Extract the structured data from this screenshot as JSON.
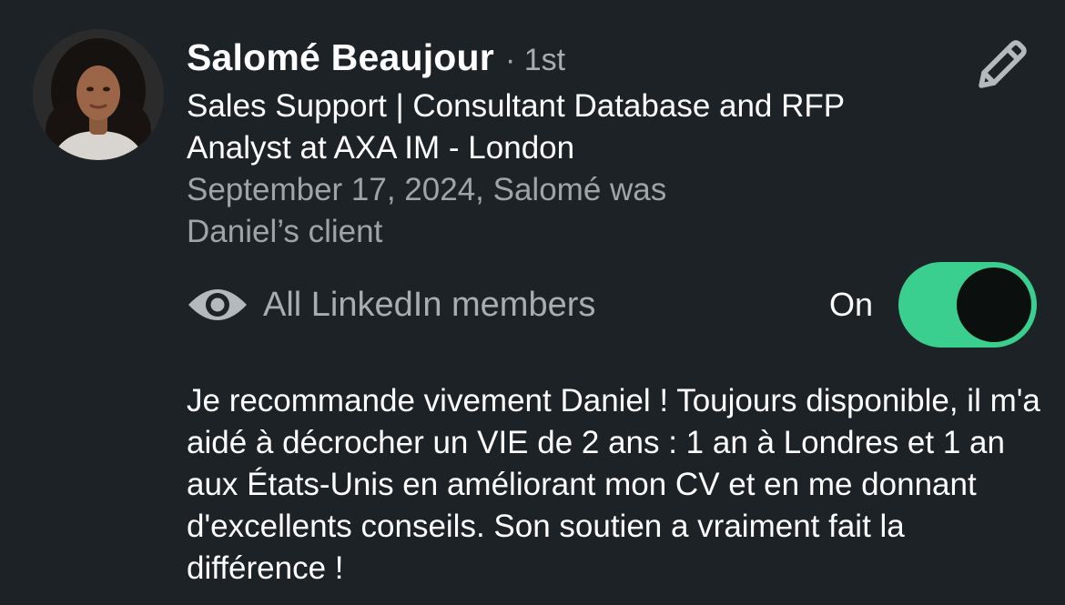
{
  "recommendation": {
    "name": "Salomé Beaujour",
    "degree": "· 1st",
    "headline": "Sales Support | Consultant Database and RFP Analyst at AXA IM - London",
    "meta": "September 17, 2024, Salomé was Daniel’s client",
    "visibility": {
      "icon": "eye-icon",
      "label": "All LinkedIn members",
      "toggle_label": "On",
      "toggle_on": true
    },
    "text": "Je recommande vivement Daniel ! Toujours disponible, il m'a aidé à décrocher un VIE de 2 ans : 1 an à Londres et 1 an aux États-Unis en améliorant mon CV et en me donnant d'excellents conseils. Son soutien a vraiment fait la différence !"
  },
  "icons": {
    "edit": "pencil-icon",
    "avatar": "profile-photo"
  },
  "colors": {
    "background": "#1d2226",
    "toggle_on": "#3acf8f",
    "secondary_text": "#a9adb1"
  }
}
